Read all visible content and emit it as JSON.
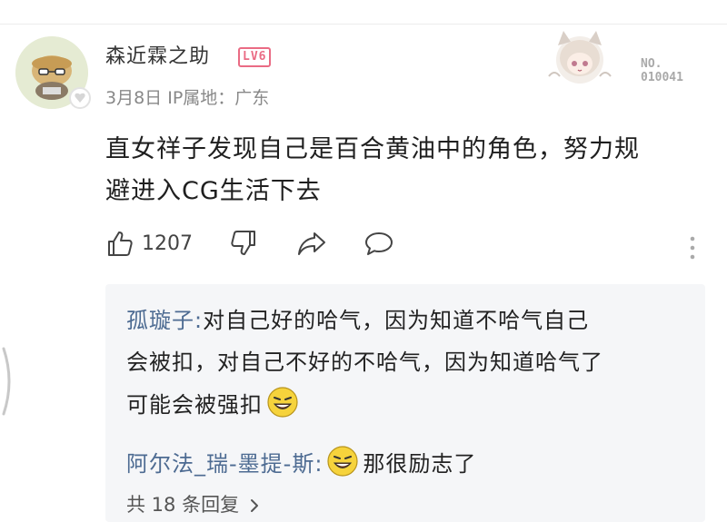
{
  "comment": {
    "username": "森近霖之助",
    "level": "LV6",
    "date": "3月8日",
    "ip_location": "IP属地：广东",
    "fan_card_no": "NO.",
    "fan_card_number": "010041",
    "text_line1": "直女祥子发现自己是百合黄油中的角色，努力规",
    "text_line2": "避进入CG生活下去",
    "like_count": "1207",
    "icons": [
      "like-icon",
      "dislike-icon",
      "share-icon",
      "reply-icon",
      "more-icon"
    ]
  },
  "replies": [
    {
      "author": "孤璇子:",
      "line1": "对自己好的哈气，因为知道不哈气自己",
      "line2": "会被扣，对自己不好的不哈气，因为知道哈气了",
      "line3": "可能会被强扣"
    },
    {
      "author": "阿尔法_瑞-墨提-斯:",
      "text": "那很励志了"
    }
  ],
  "view_replies": "共 18 条回复",
  "colors": {
    "level_badge": "#ea6b84",
    "reply_author": "#4d6b92",
    "reply_bg": "#f5f6f8",
    "meta_text": "#888888"
  }
}
